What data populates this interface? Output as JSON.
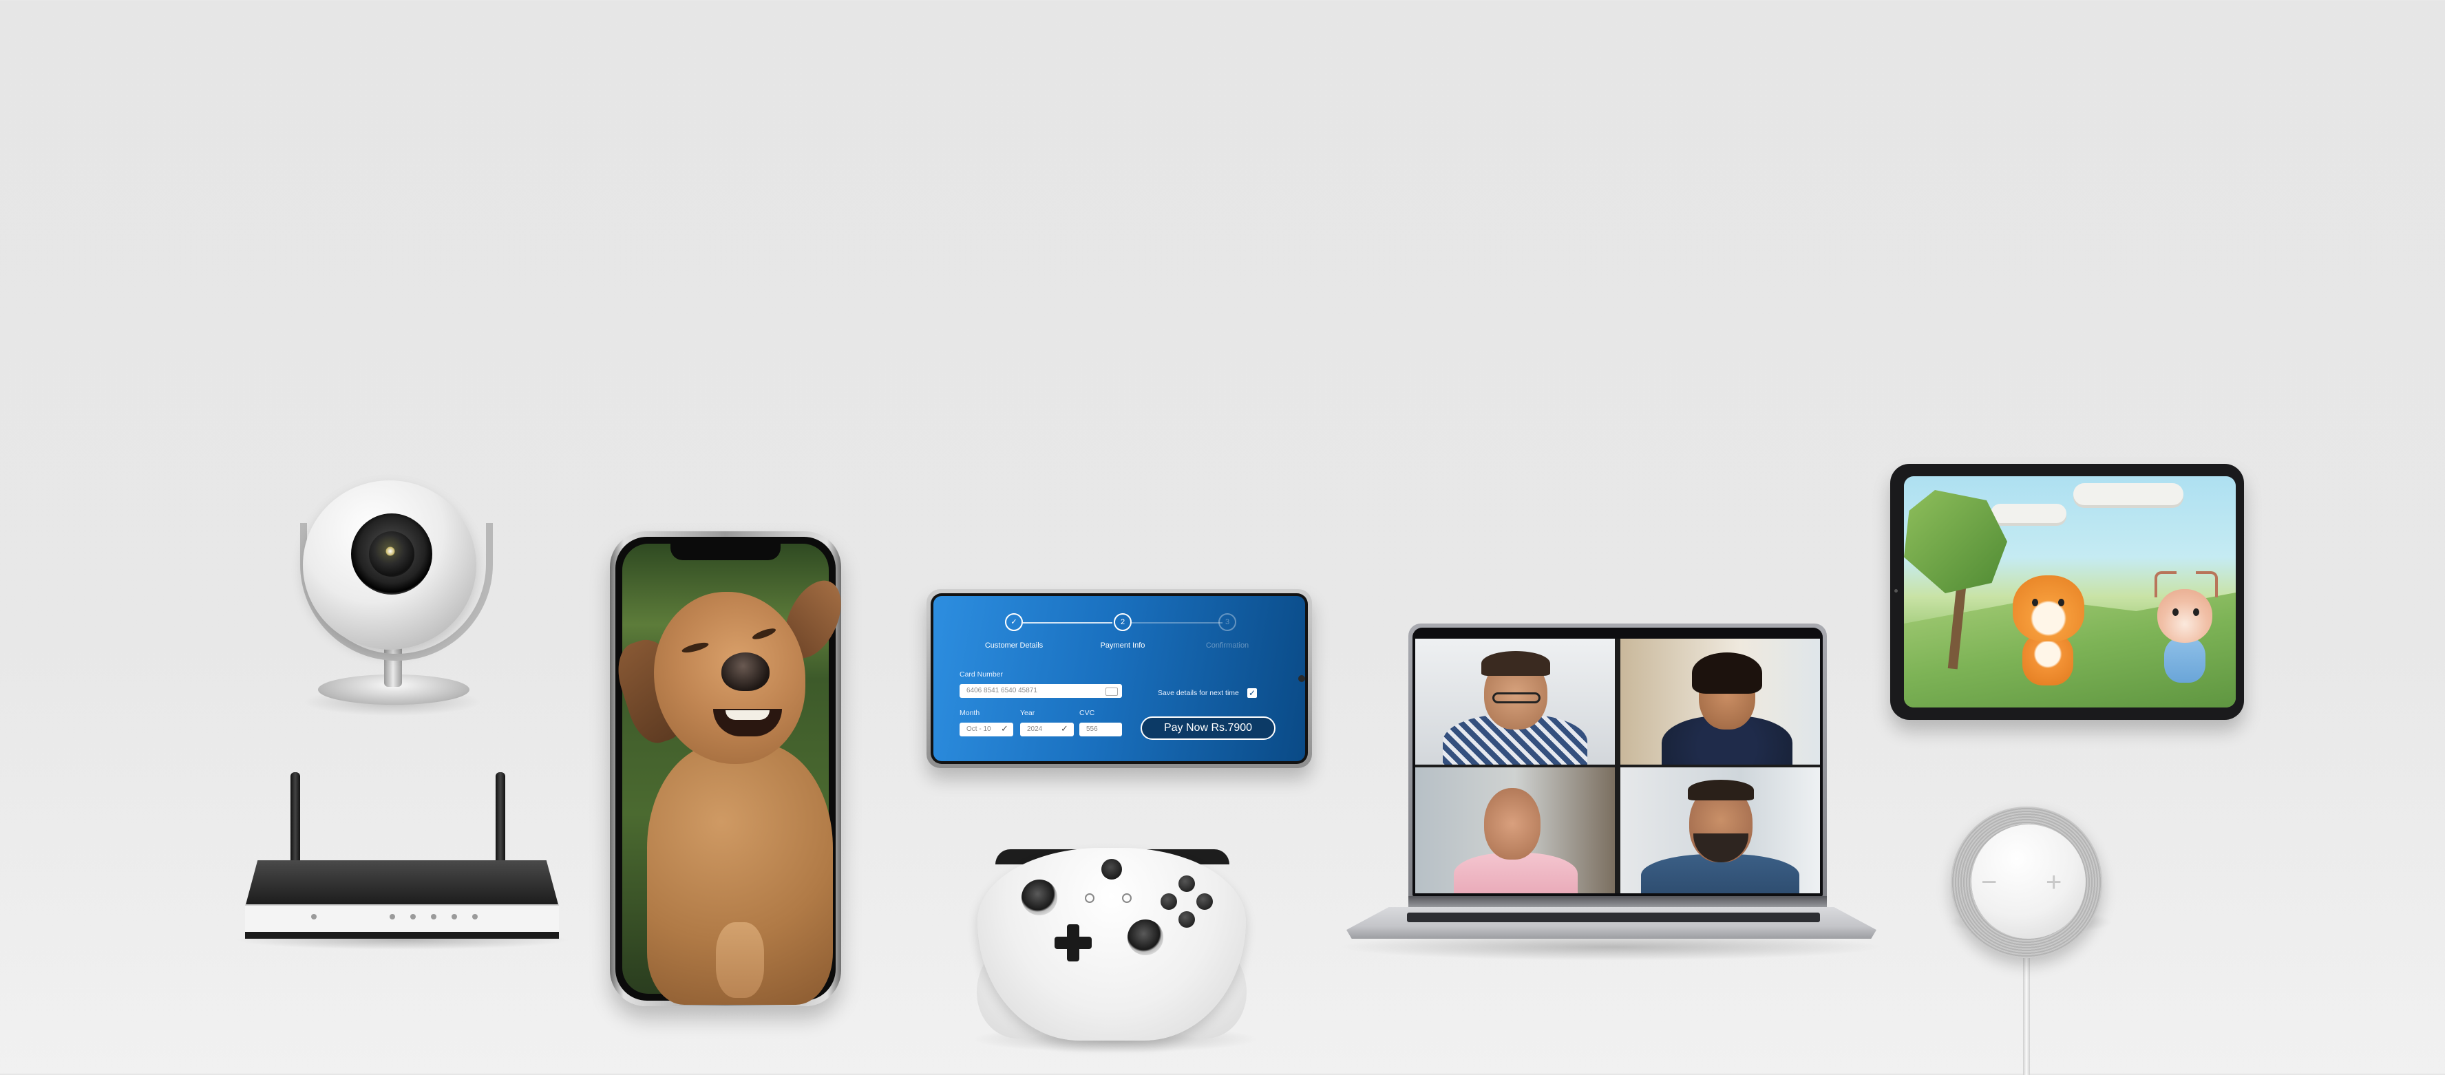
{
  "payment": {
    "steps": [
      {
        "marker": "✓",
        "label": "Customer Details"
      },
      {
        "marker": "2",
        "label": "Payment Info"
      },
      {
        "marker": "3",
        "label": "Confirmation"
      }
    ],
    "card_number_label": "Card Number",
    "card_number_value": "6406  8541  6540  45871",
    "save_details_label": "Save details for next time",
    "save_checked": "✓",
    "month_label": "Month",
    "month_value": "Oct - 10",
    "year_label": "Year",
    "year_value": "2024",
    "cvc_label": "CVC",
    "cvc_value": "556",
    "pay_button": "Pay Now  Rs.7900"
  },
  "speaker": {
    "minus": "−",
    "plus": "+"
  },
  "colors": {
    "background": "#e6e6e6",
    "payment_gradient_start": "#2d8ee0",
    "payment_gradient_end": "#0a4a86",
    "pay_button_bg": "#0c3a66"
  },
  "icons": {
    "dropdown_check": "✓",
    "card_icon": "card-icon"
  }
}
